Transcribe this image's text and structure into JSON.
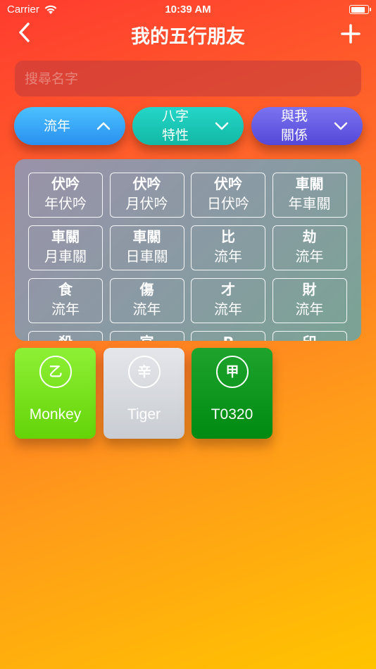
{
  "status": {
    "carrier": "Carrier",
    "time": "10:39 AM",
    "battery_level": 0.85
  },
  "nav": {
    "title": "我的五行朋友",
    "back_icon": "chevron-left-icon",
    "add_icon": "plus-icon"
  },
  "search": {
    "placeholder": "搜尋名字",
    "value": ""
  },
  "filters": [
    {
      "label": "流年",
      "icon": "chevron-up-icon",
      "color": "#3aa8f8"
    },
    {
      "label": "八字\n特性",
      "icon": "chevron-down-icon",
      "color": "#1cc7b6"
    },
    {
      "label": "與我\n關係",
      "icon": "chevron-down-icon",
      "color": "#665ce4"
    }
  ],
  "grid": [
    {
      "top": "伏吟",
      "bottom": "年伏吟"
    },
    {
      "top": "伏吟",
      "bottom": "月伏吟"
    },
    {
      "top": "伏吟",
      "bottom": "日伏吟"
    },
    {
      "top": "車關",
      "bottom": "年車關"
    },
    {
      "top": "車關",
      "bottom": "月車關"
    },
    {
      "top": "車關",
      "bottom": "日車關"
    },
    {
      "top": "比",
      "bottom": "流年"
    },
    {
      "top": "劫",
      "bottom": "流年"
    },
    {
      "top": "食",
      "bottom": "流年"
    },
    {
      "top": "傷",
      "bottom": "流年"
    },
    {
      "top": "才",
      "bottom": "流年"
    },
    {
      "top": "財",
      "bottom": "流年"
    },
    {
      "top": "殺",
      "bottom": ""
    },
    {
      "top": "官",
      "bottom": ""
    },
    {
      "top": "P",
      "bottom": ""
    },
    {
      "top": "印",
      "bottom": ""
    }
  ],
  "friends": [
    {
      "element": "乙",
      "name": "Monkey",
      "color": "#7ae21c"
    },
    {
      "element": "辛",
      "name": "Tiger",
      "color": "#d6d8dd"
    },
    {
      "element": "甲",
      "name": "T0320",
      "color": "#10971f"
    }
  ]
}
